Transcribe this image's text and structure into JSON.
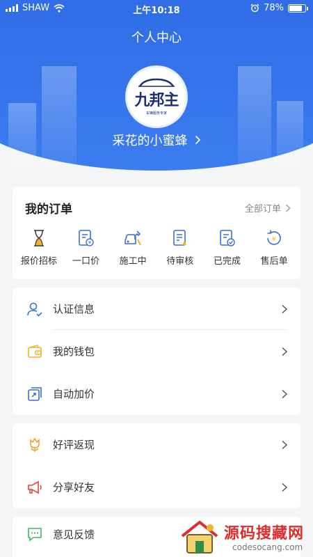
{
  "status_bar": {
    "carrier": "SHAW",
    "time": "上午10:18",
    "battery": "78%"
  },
  "header": {
    "title": "个人中心"
  },
  "profile": {
    "logo_text": "九邦主",
    "logo_subtext": "车辆服务专家",
    "username": "采花的小蜜蜂"
  },
  "orders": {
    "title": "我的订单",
    "all_label": "全部订单",
    "items": [
      {
        "label": "报价招标",
        "icon": "hourglass-icon"
      },
      {
        "label": "一口价",
        "icon": "price-document-icon"
      },
      {
        "label": "施工中",
        "icon": "car-repair-icon"
      },
      {
        "label": "待审核",
        "icon": "review-document-icon"
      },
      {
        "label": "已完成",
        "icon": "completed-document-icon"
      },
      {
        "label": "售后单",
        "icon": "after-sales-icon"
      }
    ]
  },
  "menu_group_1": [
    {
      "label": "认证信息",
      "icon": "user-verified-icon"
    },
    {
      "label": "我的钱包",
      "icon": "wallet-icon"
    },
    {
      "label": "自动加价",
      "icon": "auto-markup-icon"
    }
  ],
  "menu_group_2": [
    {
      "label": "好评返现",
      "icon": "flower-icon"
    },
    {
      "label": "分享好友",
      "icon": "megaphone-icon"
    }
  ],
  "menu_group_3": [
    {
      "label": "意见反馈",
      "icon": "feedback-icon"
    }
  ],
  "watermark": {
    "title": "源码搜藏网",
    "subtitle": "codesocang.com"
  },
  "colors": {
    "primary": "#2f6ce6",
    "icon_blue": "#3a6fd8",
    "wallet_yellow": "#f0b429",
    "flower_orange": "#f39a2b",
    "megaphone_red": "#e8413a",
    "feedback_green": "#3fb56b"
  }
}
